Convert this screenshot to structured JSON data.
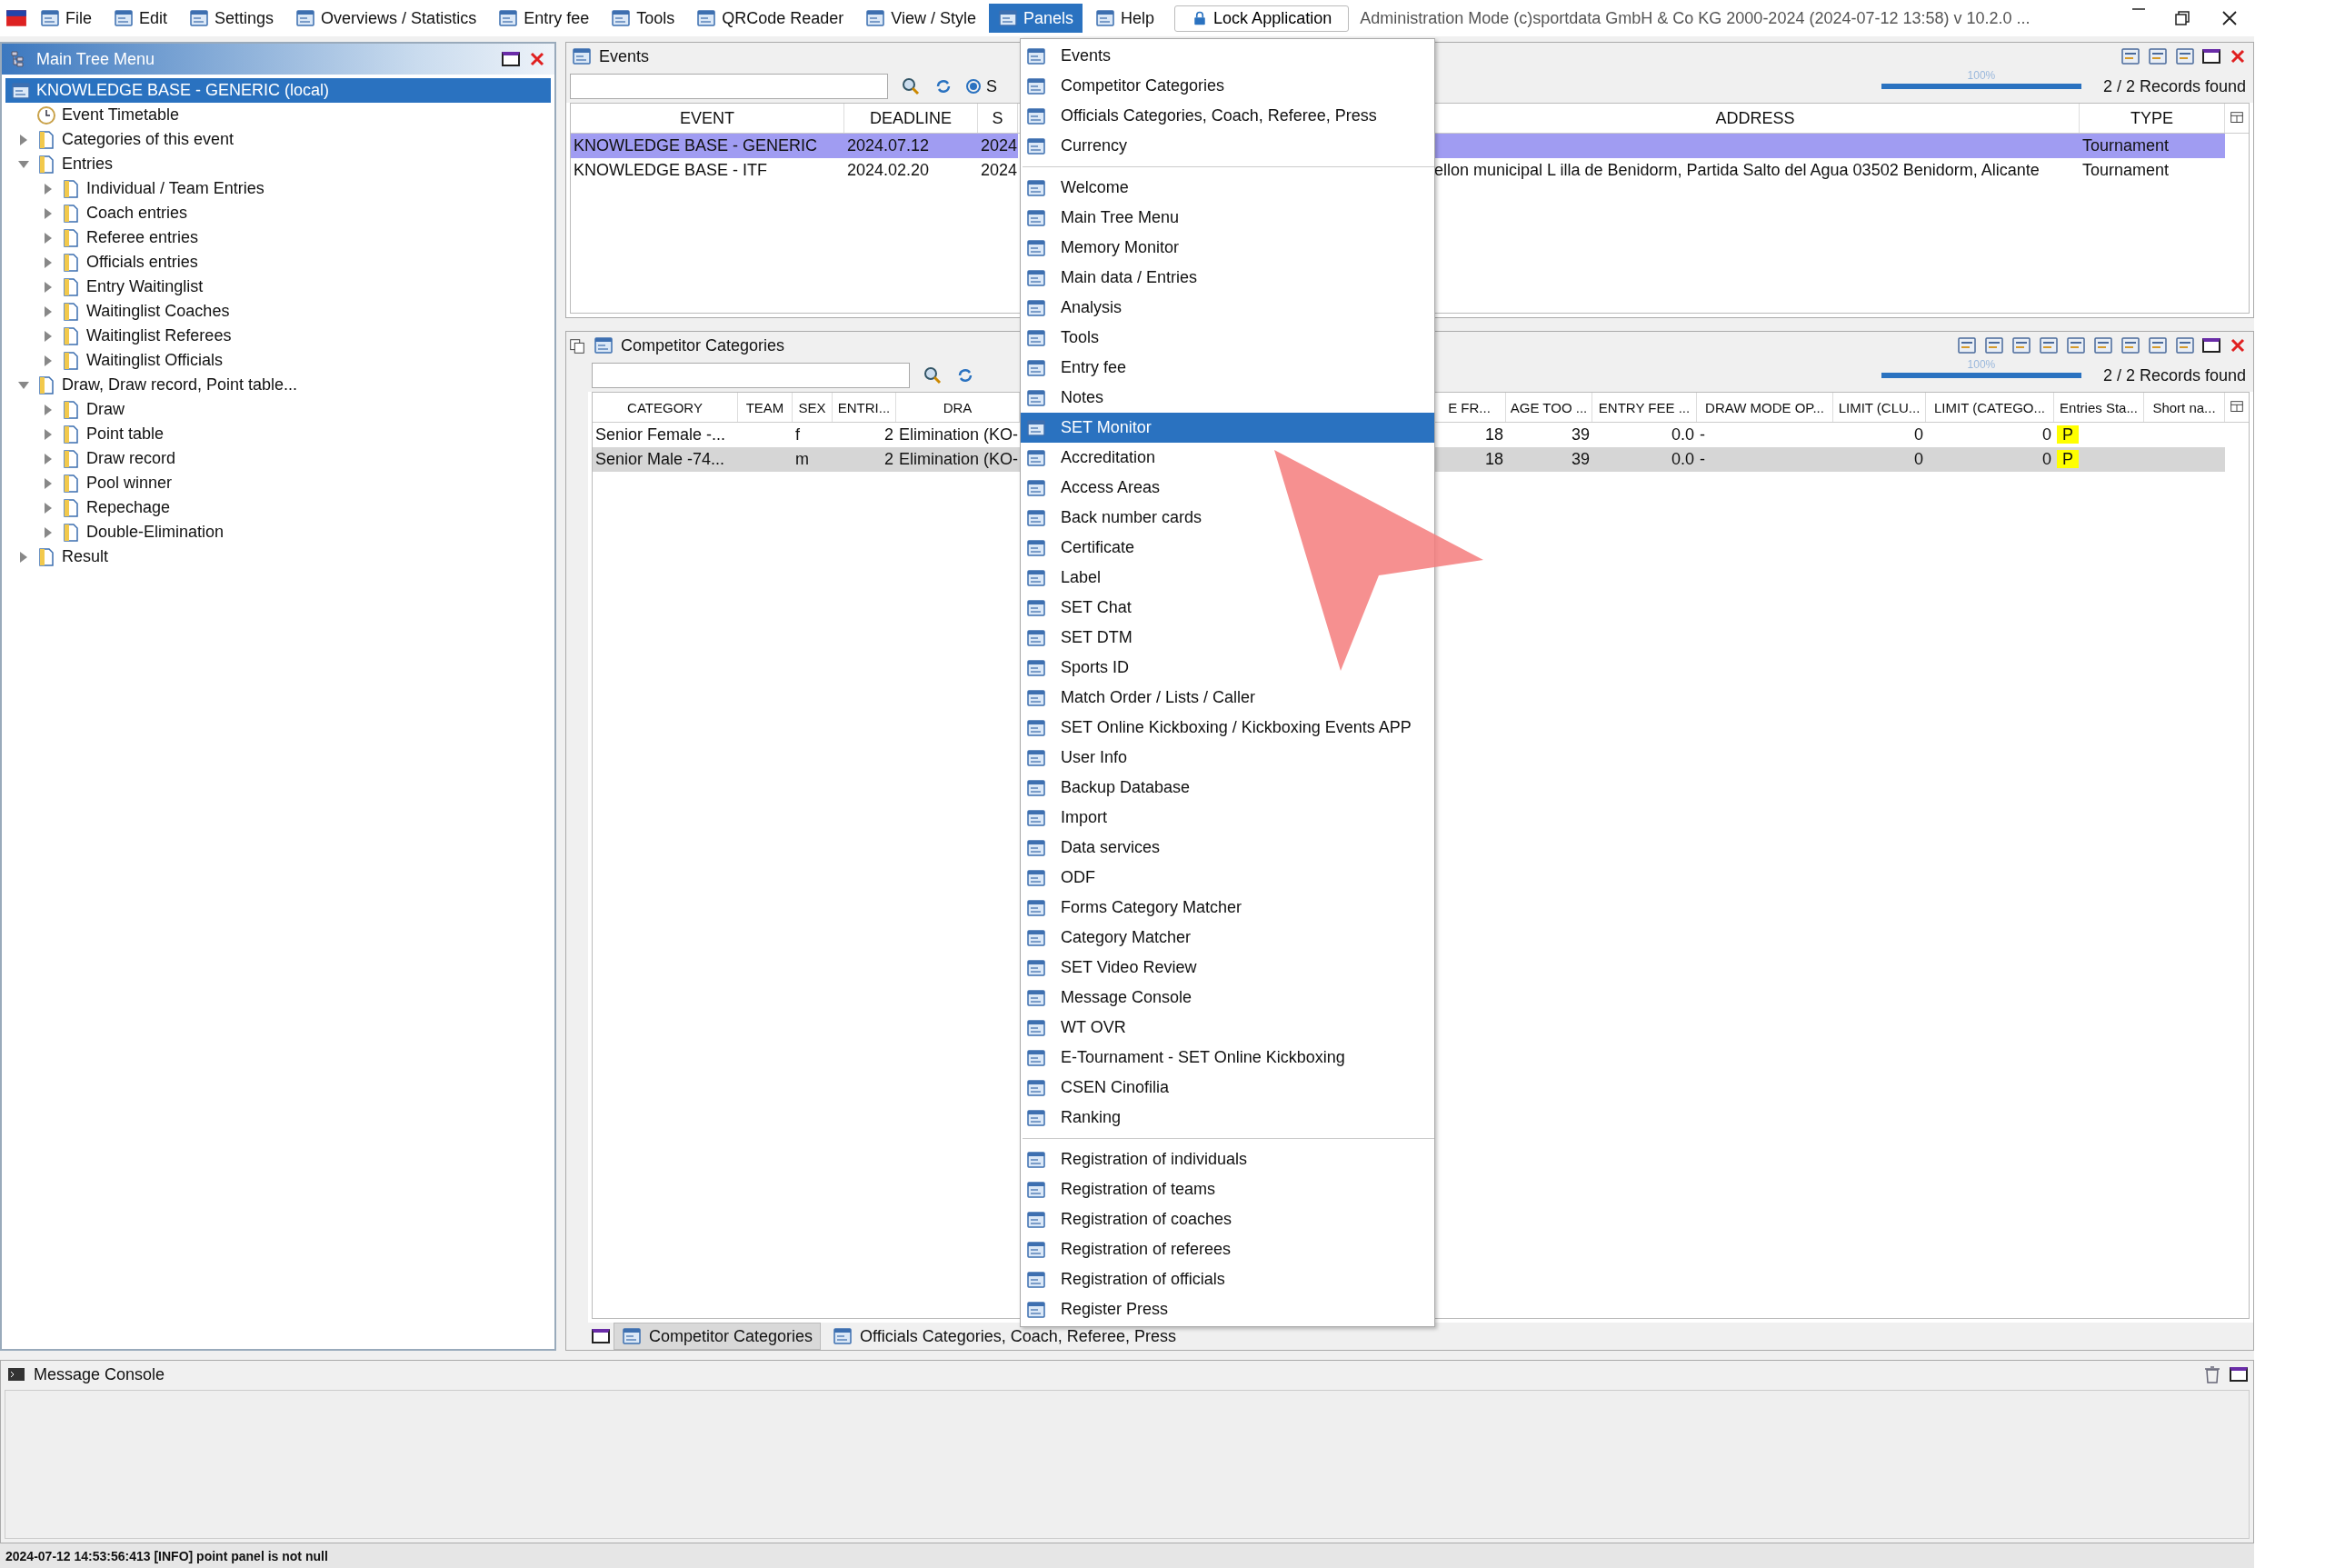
{
  "menubar": {
    "items": [
      {
        "label": "File",
        "selected": false
      },
      {
        "label": "Edit",
        "selected": false
      },
      {
        "label": "Settings",
        "selected": false
      },
      {
        "label": "Overviews / Statistics",
        "selected": false
      },
      {
        "label": "Entry fee",
        "selected": false
      },
      {
        "label": "Tools",
        "selected": false
      },
      {
        "label": "QRCode Reader",
        "selected": false
      },
      {
        "label": "View / Style",
        "selected": false
      },
      {
        "label": "Panels",
        "selected": true
      },
      {
        "label": "Help",
        "selected": false
      }
    ],
    "lock_button": "Lock Application",
    "title": "Administration Mode (c)sportdata GmbH & Co KG 2000-2024 (2024-07-12 13:58)  v 10.2.0 ..."
  },
  "tree_panel": {
    "title": "Main Tree Menu",
    "items": [
      {
        "label": "KNOWLEDGE BASE - GENERIC (local)",
        "selected": true,
        "children": [
          {
            "label": "Event Timetable",
            "selected": false
          },
          {
            "label": "Categories of this event",
            "selected": false,
            "expanded": false
          },
          {
            "label": "Entries",
            "selected": false,
            "expanded": true,
            "children": [
              {
                "label": "Individual / Team Entries",
                "selected": false,
                "expanded": false
              },
              {
                "label": "Coach entries",
                "selected": false,
                "expanded": false
              },
              {
                "label": "Referee entries",
                "selected": false,
                "expanded": false
              },
              {
                "label": "Officials entries",
                "selected": false,
                "expanded": false
              },
              {
                "label": "Entry Waitinglist",
                "selected": false,
                "expanded": false
              },
              {
                "label": "Waitinglist Coaches",
                "selected": false,
                "expanded": false
              },
              {
                "label": "Waitinglist Referees",
                "selected": false,
                "expanded": false
              },
              {
                "label": "Waitinglist Officials",
                "selected": false,
                "expanded": false
              }
            ]
          },
          {
            "label": "Draw, Draw record, Point table...",
            "selected": false,
            "expanded": true,
            "children": [
              {
                "label": "Draw",
                "selected": false,
                "expanded": false
              },
              {
                "label": "Point table",
                "selected": false,
                "expanded": false
              },
              {
                "label": "Draw record",
                "selected": false,
                "expanded": false
              },
              {
                "label": "Pool winner",
                "selected": false,
                "expanded": false
              },
              {
                "label": "Repechage",
                "selected": false,
                "expanded": false
              },
              {
                "label": "Double-Elimination",
                "selected": false,
                "expanded": false
              }
            ]
          },
          {
            "label": "Result",
            "selected": false,
            "expanded": false
          }
        ]
      }
    ]
  },
  "events_panel": {
    "title": "Events",
    "radio": {
      "label": "S",
      "selected": true
    },
    "progress": {
      "level": 1,
      "reading": "100%"
    },
    "records": "2 / 2 Records found",
    "table": {
      "columns": [
        "EVENT",
        "DEADLINE",
        "S",
        "ADDRESS",
        "TYPE"
      ],
      "rows": [
        {
          "selected": true,
          "cells": [
            "KNOWLEDGE BASE - GENERIC",
            "2024.07.12",
            "2024",
            "",
            "Tournament"
          ]
        },
        {
          "selected": false,
          "cells": [
            "KNOWLEDGE BASE - ITF",
            "2024.02.20",
            "2024",
            "ellon municipal L illa de Benidorm, Partida Salto del Agua 03502 Benidorm, Alicante",
            "Tournament"
          ]
        }
      ]
    }
  },
  "categories_panel": {
    "title": "Competitor Categories",
    "progress": {
      "level": 1,
      "reading": "100%"
    },
    "records": "2 / 2 Records found",
    "table": {
      "columns": [
        "CATEGORY",
        "TEAM",
        "SEX",
        "ENTRI...",
        "DRA",
        "E FR...",
        "AGE TOO ...",
        "ENTRY FEE ...",
        "DRAW MODE OP...",
        "LIMIT (CLU...",
        "LIMIT (CATEGO...",
        "Entries Sta...",
        "Short na..."
      ],
      "rows": [
        {
          "selected": false,
          "cells": [
            "Senior Female -...",
            "",
            "f",
            "2",
            "Elimination (KO-",
            "18",
            "39",
            "0.0",
            "-",
            "0",
            "0",
            "P",
            ""
          ]
        },
        {
          "selected": true,
          "cells": [
            "Senior Male -74...",
            "",
            "m",
            "2",
            "Elimination (KO-",
            "18",
            "39",
            "0.0",
            "-",
            "0",
            "0",
            "P",
            ""
          ]
        }
      ]
    },
    "tabs": [
      {
        "label": "Competitor Categories",
        "selected": true
      },
      {
        "label": "Officials Categories, Coach, Referee, Press",
        "selected": false
      }
    ]
  },
  "panels_menu": {
    "sections": [
      [
        {
          "label": "Events",
          "selected": false
        },
        {
          "label": "Competitor Categories",
          "selected": false
        },
        {
          "label": "Officials Categories, Coach, Referee, Press",
          "selected": false
        },
        {
          "label": "Currency",
          "selected": false
        }
      ],
      [
        {
          "label": "Welcome",
          "selected": false
        },
        {
          "label": "Main Tree Menu",
          "selected": false
        },
        {
          "label": "Memory Monitor",
          "selected": false
        },
        {
          "label": "Main data / Entries",
          "selected": false
        },
        {
          "label": "Analysis",
          "selected": false
        },
        {
          "label": "Tools",
          "selected": false
        },
        {
          "label": "Entry fee",
          "selected": false
        },
        {
          "label": "Notes",
          "selected": false
        },
        {
          "label": "SET Monitor",
          "selected": true
        },
        {
          "label": "Accreditation",
          "selected": false
        },
        {
          "label": "Access Areas",
          "selected": false
        },
        {
          "label": "Back number cards",
          "selected": false
        },
        {
          "label": "Certificate",
          "selected": false
        },
        {
          "label": "Label",
          "selected": false
        },
        {
          "label": "SET Chat",
          "selected": false
        },
        {
          "label": "SET DTM",
          "selected": false
        },
        {
          "label": "Sports ID",
          "selected": false
        },
        {
          "label": "Match Order / Lists / Caller",
          "selected": false
        },
        {
          "label": "SET Online Kickboxing / Kickboxing Events APP",
          "selected": false
        },
        {
          "label": "User Info",
          "selected": false
        },
        {
          "label": "Backup Database",
          "selected": false
        },
        {
          "label": "Import",
          "selected": false
        },
        {
          "label": "Data services",
          "selected": false
        },
        {
          "label": "ODF",
          "selected": false
        },
        {
          "label": "Forms Category Matcher",
          "selected": false
        },
        {
          "label": "Category Matcher",
          "selected": false
        },
        {
          "label": "SET Video Review",
          "selected": false
        },
        {
          "label": "Message Console",
          "selected": false
        },
        {
          "label": "WT OVR",
          "selected": false
        },
        {
          "label": "E-Tournament - SET Online Kickboxing",
          "selected": false
        },
        {
          "label": "CSEN Cinofilia",
          "selected": false
        },
        {
          "label": "Ranking",
          "selected": false
        }
      ],
      [
        {
          "label": "Registration of individuals",
          "selected": false
        },
        {
          "label": "Registration of teams",
          "selected": false
        },
        {
          "label": "Registration of coaches",
          "selected": false
        },
        {
          "label": "Registration of referees",
          "selected": false
        },
        {
          "label": "Registration of officials",
          "selected": false
        },
        {
          "label": "Register Press",
          "selected": false
        }
      ]
    ]
  },
  "console": {
    "title": "Message Console"
  },
  "status_bar": "2024-07-12 14:53:56:413 [INFO] point panel is not null"
}
